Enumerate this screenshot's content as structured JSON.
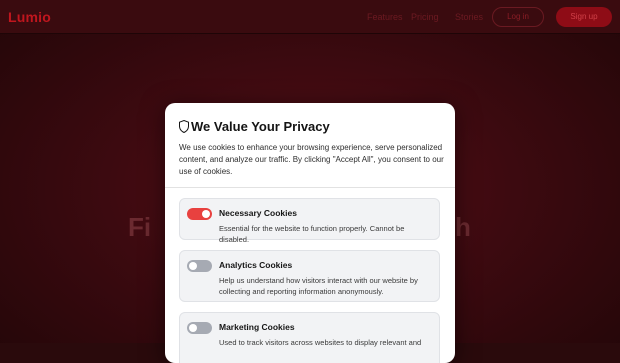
{
  "background": {
    "logo": "Lumio",
    "nav": [
      "Features",
      "Pricing",
      "Stories"
    ],
    "login_label": "Log in",
    "signup_label": "Sign up",
    "hero_left": "Fi",
    "hero_right": "h"
  },
  "modal": {
    "icon": "shield-icon",
    "title": "We Value Your Privacy",
    "description": "We use cookies to enhance your browsing experience, serve personalized content, and analyze our traffic. By clicking \"Accept All\", you consent to our use of cookies.",
    "options": [
      {
        "title": "Necessary Cookies",
        "description": "Essential for the website to function properly. Cannot be disabled.",
        "enabled": true
      },
      {
        "title": "Analytics Cookies",
        "description": "Help us understand how visitors interact with our website by collecting and reporting information anonymously.",
        "enabled": false
      },
      {
        "title": "Marketing Cookies",
        "description": "Used to track visitors across websites to display relevant and",
        "enabled": false
      }
    ]
  },
  "colors": {
    "accent": "#e8413f",
    "toggle_off": "#a6aab3",
    "overlay": "#3d0a10"
  }
}
